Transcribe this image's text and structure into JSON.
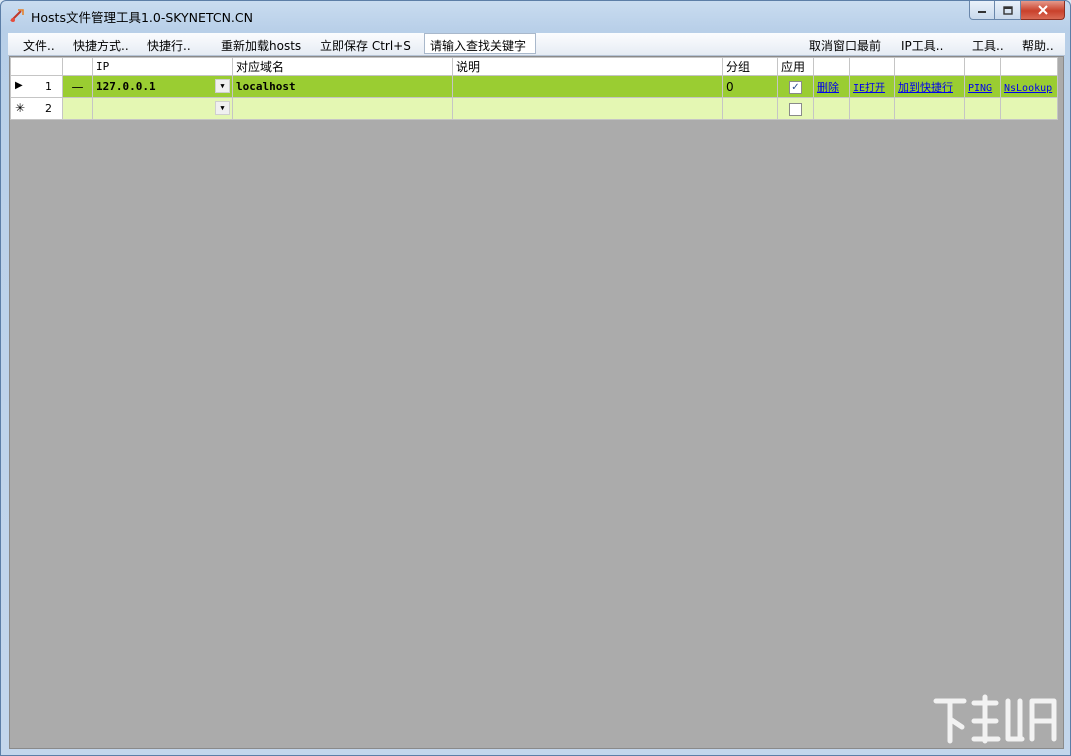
{
  "window": {
    "title": "Hosts文件管理工具1.0-SKYNETCN.CN"
  },
  "menu": {
    "file": "文件..",
    "shortcuts": "快捷方式..",
    "quick_run": "快捷行..",
    "reload": "重新加载hosts",
    "save_now": "立即保存 Ctrl+S",
    "search_placeholder": "请输入查找关键字",
    "cancel_topmost": "取消窗口最前",
    "ip_tools": "IP工具..",
    "tools": "工具..",
    "help": "帮助.."
  },
  "grid": {
    "columns": {
      "ip": "IP",
      "domain": "对应域名",
      "description": "说明",
      "group": "分组",
      "apply": "应用"
    },
    "rows": [
      {
        "number": "1",
        "marker": "▶",
        "dash": "—",
        "ip": "127.0.0.1",
        "domain": "localhost",
        "description": "",
        "group": "0",
        "apply_checked": true,
        "actions": {
          "delete": "删除",
          "ie_open": "IE打开",
          "add_quick": "加到快捷行",
          "ping": "PING",
          "nslookup": "NsLookup"
        }
      },
      {
        "number": "2",
        "marker": "✳",
        "ip": "",
        "domain": "",
        "description": "",
        "group": "",
        "apply_checked": false
      }
    ]
  },
  "colors": {
    "selected_row": "#9acd32",
    "new_row": "#e4f7b3",
    "grid_background": "#ababab"
  }
}
